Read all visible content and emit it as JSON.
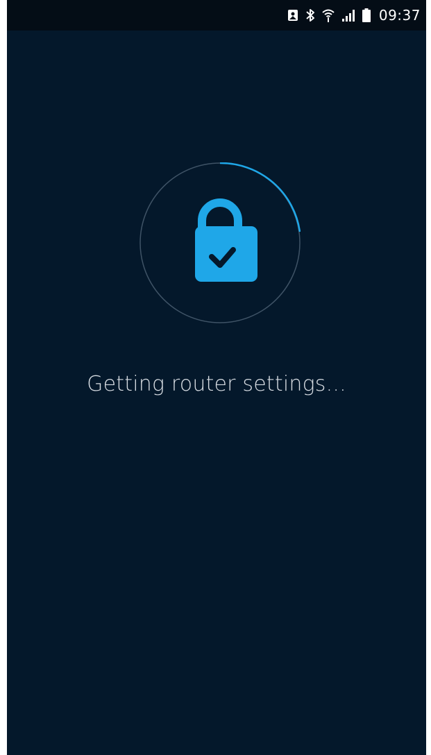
{
  "status_bar": {
    "time": "09:37",
    "icons": [
      "photo-notification-icon",
      "bluetooth-icon",
      "wifi-icon",
      "cell-signal-icon",
      "battery-icon"
    ]
  },
  "loading": {
    "icon": "lock-check-icon",
    "message": "Getting router settings..."
  },
  "colors": {
    "background": "#04182b",
    "status_bar": "#040d16",
    "accent": "#1fa7e8",
    "ring": "#3f5366"
  }
}
